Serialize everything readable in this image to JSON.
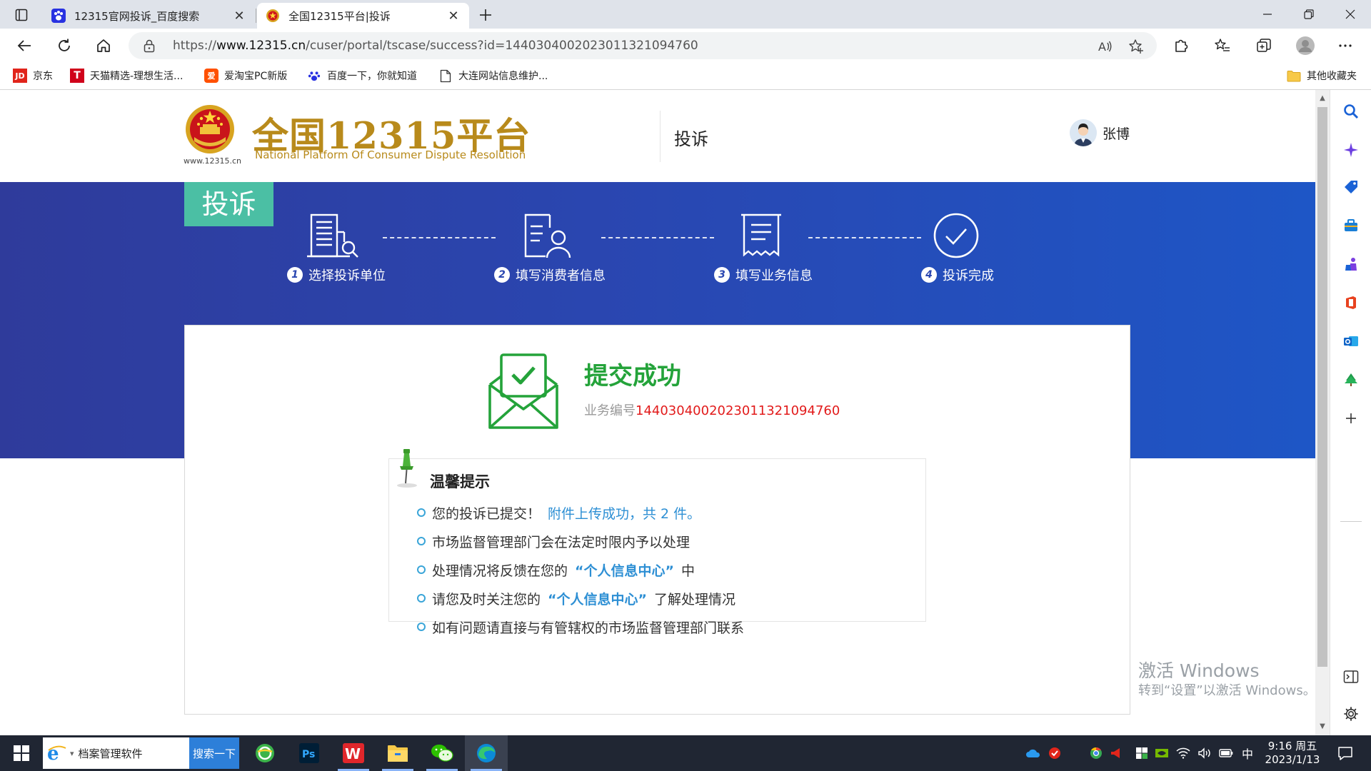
{
  "browser": {
    "tabs": [
      {
        "title": "12315官网投诉_百度搜索",
        "active": false,
        "favicon": "baidu-paw-icon"
      },
      {
        "title": "全国12315平台|投诉",
        "active": true,
        "favicon": "national-emblem-icon"
      }
    ],
    "address_bar": {
      "url_prefix": "https://",
      "url_host": "www.12315.cn",
      "url_path": "/cuser/portal/tscase/success?id=144030400202301132109476​0"
    },
    "favorites": [
      {
        "label": "京东",
        "icon": "jd-icon"
      },
      {
        "label": "天猫精选-理想生活...",
        "icon": "tmall-icon"
      },
      {
        "label": "爱淘宝PC新版",
        "icon": "aitaobao-icon"
      },
      {
        "label": "百度一下，你就知道",
        "icon": "baidu-paw-icon"
      },
      {
        "label": "大连网站信息维护...",
        "icon": "page-icon"
      }
    ],
    "other_favorites": "其他收藏夹"
  },
  "header": {
    "logo_title": "全国12315平台",
    "logo_subtitle": "National Platform Of Consumer Dispute Resolution",
    "logo_url": "www.12315.cn",
    "nav_item": "投诉",
    "user_name": "张博"
  },
  "banner": {
    "tag": "投诉",
    "steps": [
      {
        "num": "1",
        "label": "选择投诉单位",
        "icon": "building-search-icon"
      },
      {
        "num": "2",
        "label": "填写消费者信息",
        "icon": "user-form-icon"
      },
      {
        "num": "3",
        "label": "填写业务信息",
        "icon": "document-icon"
      },
      {
        "num": "4",
        "label": "投诉完成",
        "icon": "check-circle-icon"
      }
    ]
  },
  "result": {
    "title": "提交成功",
    "biz_label": "业务编号",
    "biz_number": "1440304002023011321094760",
    "colors": {
      "success": "#24a33a",
      "number": "#e21b1b",
      "accent": "#2d8fd4"
    }
  },
  "tips": {
    "title": "温馨提示",
    "items": [
      {
        "pre": "您的投诉已提交！",
        "hl": "附件上传成功，共 2 件。",
        "post": ""
      },
      {
        "pre": "市场监督管理部门会在法定时限内予以处理",
        "hl": "",
        "post": ""
      },
      {
        "pre": "处理情况将反馈在您的",
        "hl": "“个人信息中心”",
        "post": "中"
      },
      {
        "pre": "请您及时关注您的",
        "hl": "“个人信息中心”",
        "post": "了解处理情况"
      },
      {
        "pre": "如有问题请直接与有管辖权的市场监督管理部门联系",
        "hl": "",
        "post": ""
      }
    ]
  },
  "watermark": {
    "line1": "激活 Windows",
    "line2": "转到“设置”以激活 Windows。"
  },
  "taskbar": {
    "search_value": "档案管理软件",
    "search_button": "搜索一下",
    "ime": "中",
    "time": "9:16 周五",
    "date": "2023/1/13"
  }
}
